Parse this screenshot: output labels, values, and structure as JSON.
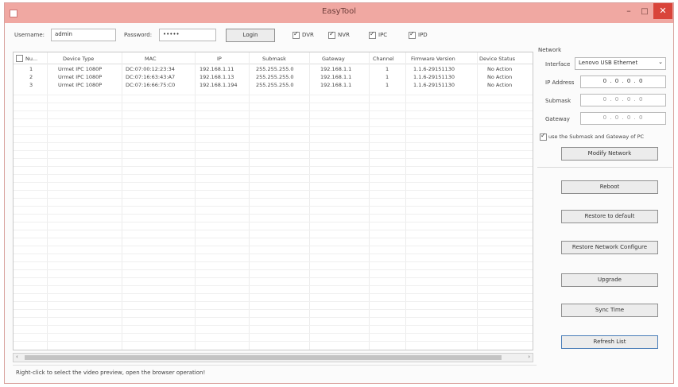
{
  "window": {
    "title": "EasyTool",
    "minimize": "–",
    "maximize": "□",
    "close": "✕"
  },
  "login": {
    "username_label": "Username:",
    "username_value": "admin",
    "password_label": "Password:",
    "password_value": "•••••",
    "login_button": "Login",
    "filters": [
      {
        "label": "DVR",
        "checked": true
      },
      {
        "label": "NVR",
        "checked": true
      },
      {
        "label": "IPC",
        "checked": true
      },
      {
        "label": "IPD",
        "checked": true
      }
    ]
  },
  "table": {
    "columns": [
      "Nu...",
      "Device Type",
      "MAC",
      "IP",
      "Submask",
      "Gateway",
      "Channel",
      "Firmware Version",
      "Device Status"
    ],
    "rows": [
      [
        "1",
        "Urmet IPC 1080P",
        "DC:07:00:12:23:34",
        "192.168.1.11",
        "255.255.255.0",
        "192.168.1.1",
        "1",
        "1.1.6-29151130",
        "No Action"
      ],
      [
        "2",
        "Urmet IPC 1080P",
        "DC:07:16:63:43:A7",
        "192.168.1.13",
        "255.255.255.0",
        "192.168.1.1",
        "1",
        "1.1.6-29151130",
        "No Action"
      ],
      [
        "3",
        "Urmet IPC 1080P",
        "DC:07:16:66:75:C0",
        "192.168.1.194",
        "255.255.255.0",
        "192.168.1.1",
        "1",
        "1.1.6-29151130",
        "No Action"
      ]
    ]
  },
  "status_text": "Right-click to select the video preview, open the browser operation!",
  "network": {
    "group_label": "Network",
    "interface_label": "Interface",
    "interface_value": "Lenovo USB Ethernet",
    "ip_label": "IP Address",
    "ip_value": "0 . 0 . 0 . 0",
    "submask_label": "Submask",
    "submask_value": "0 . 0 . 0 . 0",
    "gateway_label": "Gateway",
    "gateway_value": "0 . 0 . 0 . 0",
    "use_pc_label": "use the Submask and Gateway of PC",
    "modify_button": "Modify Network"
  },
  "actions": {
    "reboot": "Reboot",
    "restore_default": "Restore to default",
    "restore_network": "Restore Network Configure",
    "upgrade": "Upgrade",
    "sync_time": "Sync Time",
    "refresh_list": "Refresh List"
  }
}
